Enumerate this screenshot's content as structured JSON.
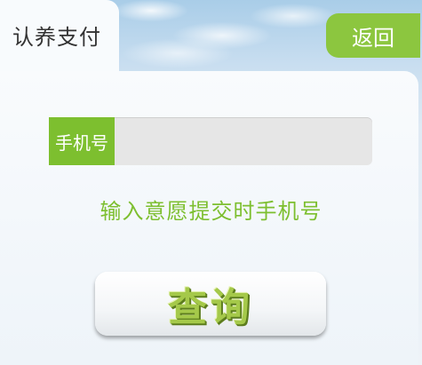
{
  "header": {
    "title": "认养支付",
    "back_label": "返回"
  },
  "form": {
    "phone_label": "手机号",
    "phone_value": "",
    "hint": "输入意愿提交时手机号"
  },
  "actions": {
    "query_label": "查询"
  },
  "colors": {
    "accent_green": "#8cc63f",
    "label_green": "#7dbf2f"
  }
}
